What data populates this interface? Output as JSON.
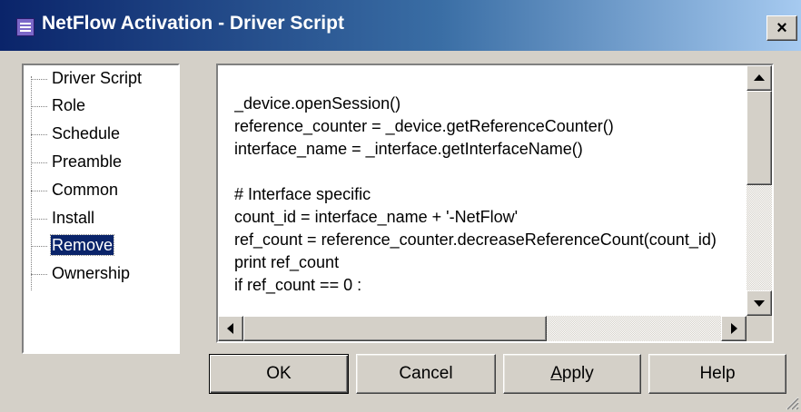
{
  "window": {
    "title": "NetFlow Activation - Driver Script",
    "close_label": "×"
  },
  "tree": {
    "items": [
      {
        "label": "Driver Script",
        "selected": false
      },
      {
        "label": "Role",
        "selected": false
      },
      {
        "label": "Schedule",
        "selected": false
      },
      {
        "label": "Preamble",
        "selected": false
      },
      {
        "label": "Common",
        "selected": false
      },
      {
        "label": "Install",
        "selected": false
      },
      {
        "label": "Remove",
        "selected": true
      },
      {
        "label": "Ownership",
        "selected": false
      }
    ]
  },
  "editor": {
    "lines": [
      "_device.openSession()",
      "reference_counter = _device.getReferenceCounter()",
      "interface_name = _interface.getInterfaceName()",
      "",
      "# Interface specific",
      "count_id = interface_name + '-NetFlow'",
      "ref_count = reference_counter.decreaseReferenceCount(count_id)",
      "print ref_count",
      "if ref_count == 0 :"
    ]
  },
  "buttons": {
    "ok": "OK",
    "cancel": "Cancel",
    "apply_first": "A",
    "apply_rest": "pply",
    "help": "Help"
  },
  "colors": {
    "titlebar_start": "#0a246a",
    "titlebar_end": "#a6caf0",
    "face": "#d4d0c8",
    "selection": "#0a246a"
  }
}
